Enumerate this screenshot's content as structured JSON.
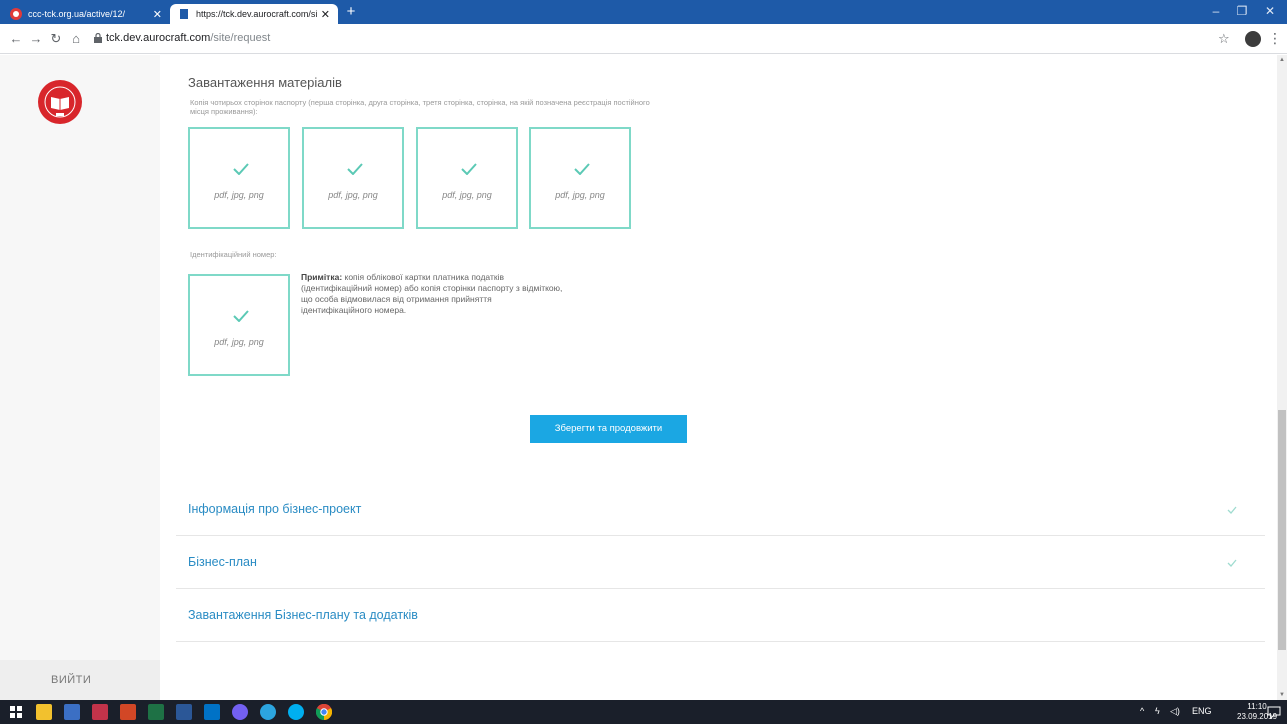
{
  "browser": {
    "tabs": [
      {
        "title": "ccc-tck.org.ua/active/12/",
        "active": false
      },
      {
        "title": "https://tck.dev.aurocraft.com/site/request",
        "active": true
      }
    ],
    "url_host": "tck.dev.aurocraft.com",
    "url_path": "/site/request"
  },
  "sidebar": {
    "logout_label": "вийти"
  },
  "upload_section": {
    "title": "Завантаження матеріалів",
    "passport_label": "Копія чотирьох сторінок паспорту (перша сторінка, друга сторінка, третя сторінка, сторінка, на якій позначена реєстрація постійного місця проживання):",
    "boxes": [
      {
        "formats": "pdf, jpg, png",
        "uploaded": true
      },
      {
        "formats": "pdf, jpg, png",
        "uploaded": true
      },
      {
        "formats": "pdf, jpg, png",
        "uploaded": true
      },
      {
        "formats": "pdf, jpg, png",
        "uploaded": true
      }
    ],
    "id_label": "Ідентифікаційний номер:",
    "id_box": {
      "formats": "pdf, jpg, png",
      "uploaded": true
    },
    "note_bold": "Примітка:",
    "note_text": " копія облікової картки платника податків (ідентифікаційний номер) або копія сторінки паспорту з відміткою, що особа відмовилася від отримання прийняття ідентифікаційного номера.",
    "save_button": "Зберегти та продовжити"
  },
  "accordion": [
    {
      "title": "Інформація про бізнес-проект",
      "completed": true
    },
    {
      "title": "Бізнес-план",
      "completed": true
    },
    {
      "title": "Завантаження Бізнес-плану та додатків",
      "completed": false
    }
  ],
  "taskbar": {
    "language": "ENG",
    "time": "11:10",
    "date": "23.09.2019"
  },
  "colors": {
    "accent_teal": "#7fd9c8",
    "button_blue": "#1ba7e3",
    "link_blue": "#2a8cc4",
    "tab_bar": "#1e5aa8"
  }
}
